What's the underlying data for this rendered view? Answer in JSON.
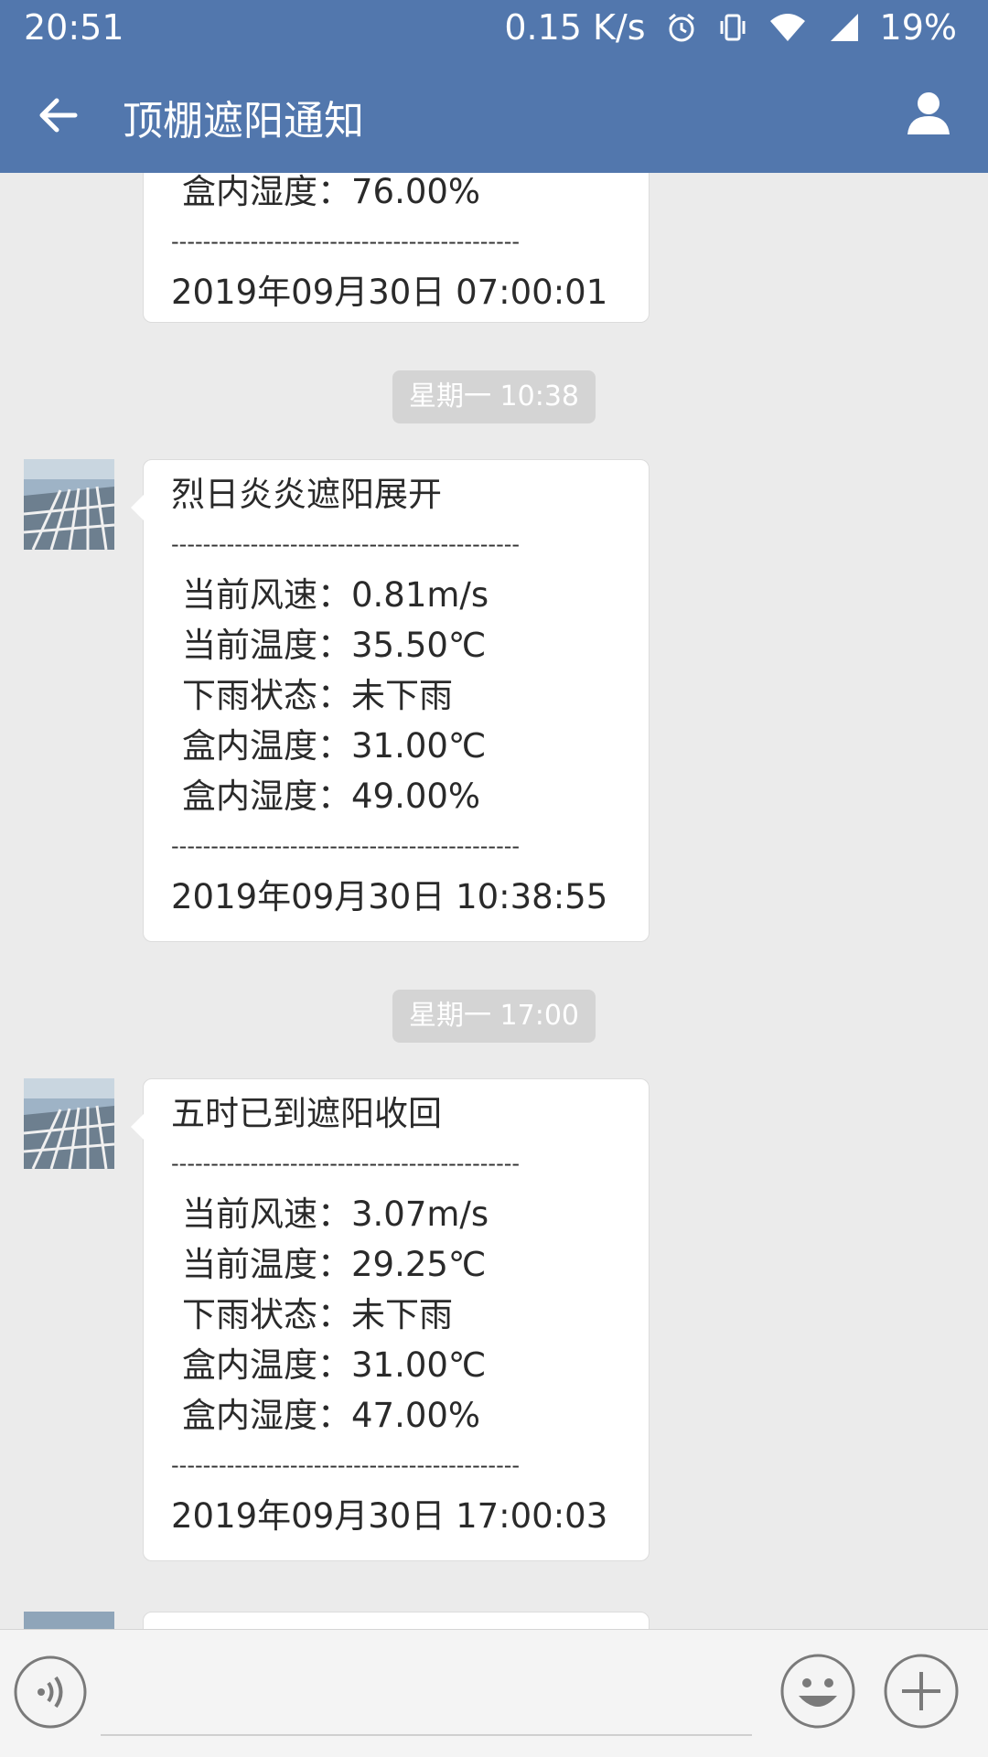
{
  "status_bar": {
    "time": "20:51",
    "network_speed": "0.15 K/s",
    "battery": "19%",
    "icons": [
      "alarm-icon",
      "vibrate-icon",
      "wifi-icon",
      "signal-icon"
    ]
  },
  "app_bar": {
    "title": "顶棚遮阳通知",
    "back_icon": "back-arrow-icon",
    "profile_icon": "user-icon",
    "color": "#5277ad"
  },
  "messages": [
    {
      "partial": true,
      "humidity": "盒内湿度：76.00%",
      "separator": "--------------------------------------------",
      "timestamp": "2019年09月30日 07:00:01"
    },
    {
      "time_badge": "星期一 10:38",
      "header": "烈日炎炎遮阳展开",
      "separator": "--------------------------------------------",
      "lines": [
        "当前风速：0.81m/s",
        "当前温度：35.50℃",
        "下雨状态：未下雨",
        "盒内温度：31.00℃",
        "盒内湿度：49.00%"
      ],
      "timestamp": "2019年09月30日 10:38:55"
    },
    {
      "time_badge": "星期一 17:00",
      "header": "五时已到遮阳收回",
      "separator": "--------------------------------------------",
      "lines": [
        "当前风速：3.07m/s",
        "当前温度：29.25℃",
        "下雨状态：未下雨",
        "盒内温度：31.00℃",
        "盒内湿度：47.00%"
      ],
      "timestamp": "2019年09月30日 17:00:03"
    }
  ],
  "input_bar": {
    "voice_icon": "voice-icon",
    "emoji_icon": "emoji-icon",
    "plus_icon": "plus-icon"
  }
}
